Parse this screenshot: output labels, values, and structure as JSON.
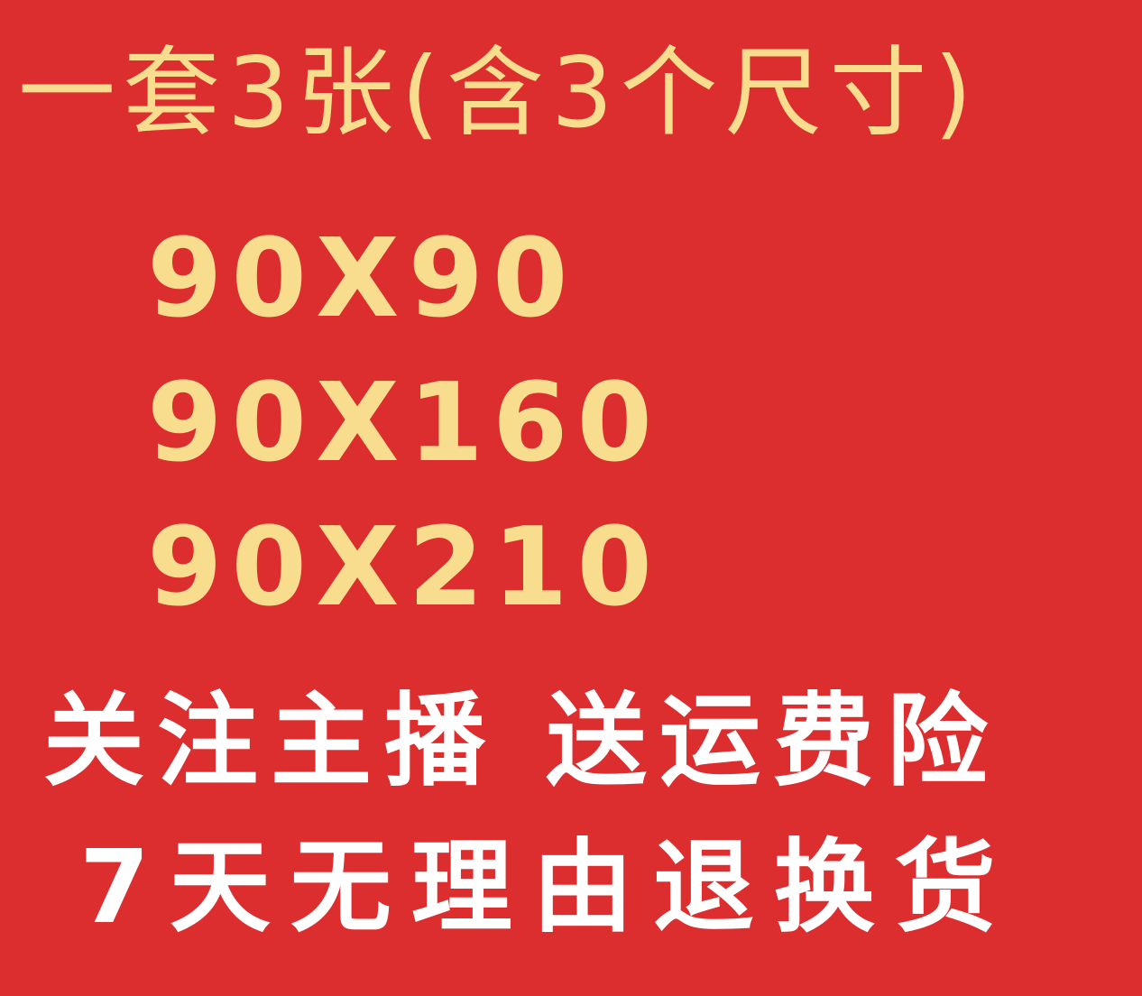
{
  "colors": {
    "background": "#dc2e2e",
    "size_text": "#f9dd8e",
    "promo_text": "#ffffff"
  },
  "banner": {
    "title": "一套3张(含3个尺寸)",
    "sizes": [
      "90X90",
      "90X160",
      "90X210"
    ],
    "promo_line_1": "关注主播 送运费险",
    "promo_line_2": "7天无理由退换货"
  }
}
